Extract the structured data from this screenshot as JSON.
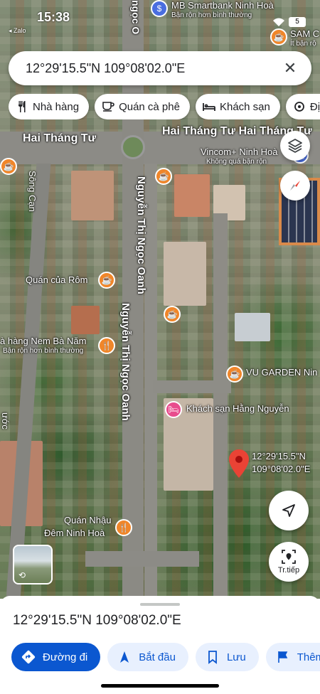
{
  "status_bar": {
    "time": "15:38",
    "back_app": "◂ Zalo",
    "battery": "5"
  },
  "search": {
    "query": "12°29'15.5\"N 109°08'02.0\"E"
  },
  "chips": [
    {
      "label": "Nhà hàng",
      "icon": "restaurant-icon"
    },
    {
      "label": "Quán cà phê",
      "icon": "cafe-icon"
    },
    {
      "label": "Khách sạn",
      "icon": "hotel-icon"
    },
    {
      "label": "Địa",
      "icon": "place-icon"
    }
  ],
  "map_labels": {
    "street_hai_thang_tu_left": "Hai Tháng Tư",
    "street_hai_thang_tu_right": "Hai Tháng Tư Hai Tháng Tư",
    "street_nguyen_thi_ngoc_oanh_1": "Nguyễn Thị Ngọc Oanh",
    "street_nguyen_thi_ngoc_oanh_2": "Nguyễn Thị Ngọc Oanh",
    "street_top_vertical": "ngọc O",
    "street_song_can": "Sông Cạn",
    "street_left_bottom": "ước",
    "mb_smartbank": "MB Smartbank Ninh Hoà",
    "mb_smartbank_sub": "Bận rộn hơn bình thường",
    "sam_c": "SAM C",
    "sam_c_sub": "Ít bận rộ",
    "vincom": "Vincom+ Ninh Hoà",
    "vincom_sub": "Không quá bận rộn",
    "quan_cua_rom": "Quán của Rôm",
    "nem_ba_nam": "à hàng Nem Bà Năm",
    "nem_ba_nam_sub": "Bận rộn hơn bình thường",
    "vu_garden": "VU GARDEN Nin",
    "khach_san_hang_nguyen": "Khách sạn Hằng Nguyễn",
    "quan_nhau": "Quán Nhậu",
    "quan_nhau_2": "Đêm Ninh Hoà"
  },
  "pin": {
    "line1": "12°29'15.5\"N",
    "line2": "109°08'02.0\"E"
  },
  "streetview_label": "Tr.tiếp",
  "sheet": {
    "coords": "12°29'15.5\"N 109°08'02.0\"E",
    "actions": [
      {
        "label": "Đường đi",
        "icon": "directions-icon",
        "primary": true
      },
      {
        "label": "Bắt đầu",
        "icon": "navigation-arrow-icon",
        "primary": false
      },
      {
        "label": "Lưu",
        "icon": "bookmark-icon",
        "primary": false
      },
      {
        "label": "Thêm",
        "icon": "flag-icon",
        "primary": false
      }
    ]
  },
  "colors": {
    "accent_blue": "#0b57d0",
    "pin_red": "#ea4335",
    "poi_orange": "#f0862a",
    "poi_pink": "#e84c8d"
  }
}
